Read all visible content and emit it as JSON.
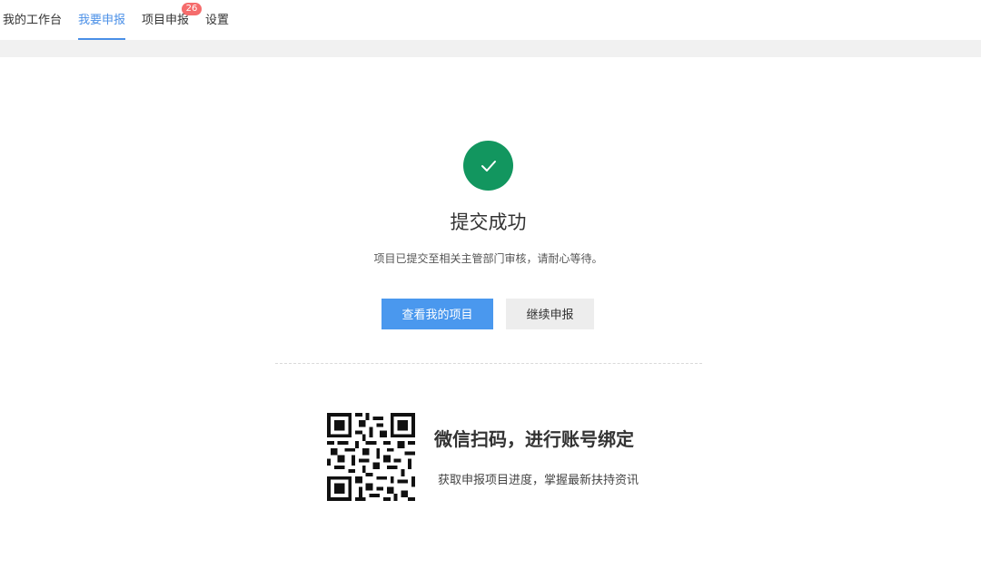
{
  "nav": {
    "tabs": [
      {
        "label": "我的工作台"
      },
      {
        "label": "我要申报",
        "active": true
      },
      {
        "label": "项目申报",
        "badge": "26"
      },
      {
        "label": "设置"
      }
    ]
  },
  "result": {
    "title": "提交成功",
    "description": "项目已提交至相关主管部门审核，请耐心等待。",
    "icon": "check-icon",
    "icon_color": "#12965f"
  },
  "actions": {
    "primary_label": "查看我的项目",
    "secondary_label": "继续申报"
  },
  "wechat": {
    "title": "微信扫码，进行账号绑定",
    "description": "获取申报项目进度，掌握最新扶持资讯"
  },
  "colors": {
    "accent": "#4a8fe7",
    "badge": "#f56c6c",
    "success": "#12965f"
  }
}
